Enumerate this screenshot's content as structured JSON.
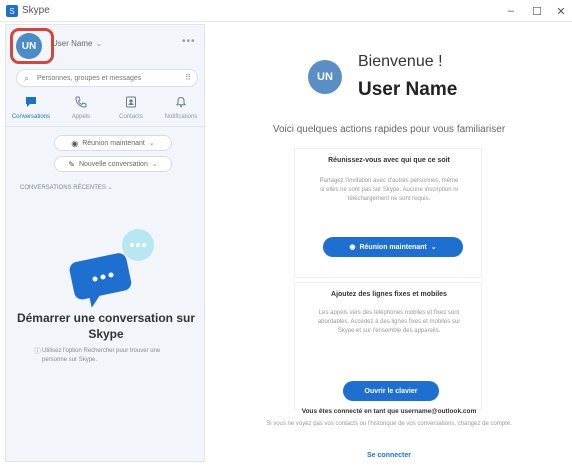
{
  "window": {
    "title": "Skype",
    "minimize": "–",
    "maximize": "☐",
    "close": "✕"
  },
  "sidebar": {
    "profile": {
      "initials": "UN",
      "name": "User Name",
      "more": "•••"
    },
    "search": {
      "placeholder": "Personnes, groupes et messages"
    },
    "tabs": [
      {
        "label": "Conversations",
        "icon": "chat-icon",
        "active": true
      },
      {
        "label": "Appels",
        "icon": "phone-icon",
        "active": false
      },
      {
        "label": "Contacts",
        "icon": "contacts-icon",
        "active": false
      },
      {
        "label": "Notifications",
        "icon": "bell-icon",
        "active": false
      }
    ],
    "meet_now": "Réunion maintenant",
    "new_chat": "Nouvelle conversation",
    "recent_label": "CONVERSATIONS RÉCENTES",
    "empty_title": "Démarrer une conversation sur Skype",
    "empty_desc": "Utilisez l'option Rechercher pour trouver une personne sur Skype."
  },
  "main": {
    "initials": "UN",
    "welcome": "Bienvenue !",
    "username": "User Name",
    "subtitle": "Voici quelques actions rapides pour vous familiariser",
    "card1": {
      "title": "Réunissez-vous avec qui que ce soit",
      "desc": "Partagez l'invitation avec d'autres personnes, même si elles ne sont pas sur Skype. Aucune inscription ni téléchargement ne sont requis.",
      "button": "Réunion maintenant"
    },
    "card2": {
      "title": "Ajoutez des lignes fixes et mobiles",
      "desc": "Les appels vers des téléphones mobiles et fixes sont abordables. Accédez à des lignes fixes et mobiles sur Skype et sur l'ensemble des appareils.",
      "button": "Ouvrir le clavier"
    },
    "footer_note": "Vous êtes connecté en tant que username@outlook.com",
    "footer_desc": "Si vous ne voyez pas vos contacts ou l'historique de vos conversations, changez de compte.",
    "footer_link": "Se connecter"
  },
  "colors": {
    "accent": "#1f6fd0",
    "highlight": "#d2473a",
    "sidebar_bg": "#f2f6fb"
  }
}
